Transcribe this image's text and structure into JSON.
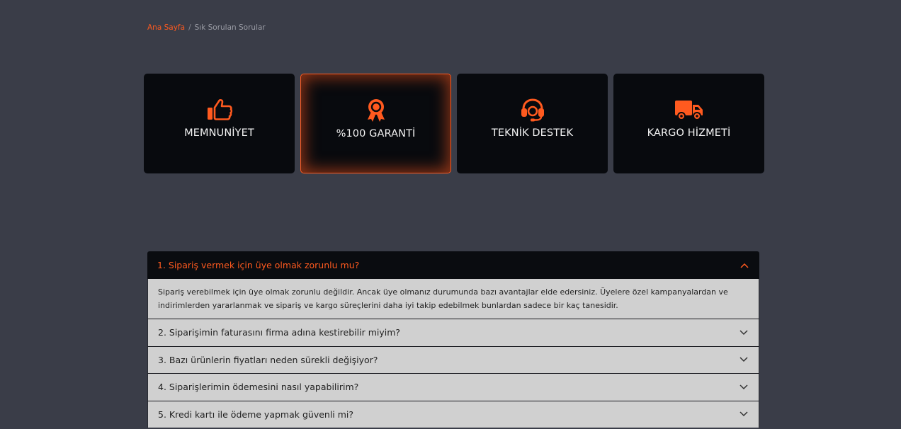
{
  "breadcrumb": {
    "home": "Ana Sayfa",
    "separator": "/",
    "current": "Sık Sorulan Sorular"
  },
  "features": [
    {
      "label": "MEMNUNİYET",
      "icon": "thumbs-up-icon"
    },
    {
      "label": "%100 GARANTİ",
      "icon": "award-ribbon-icon"
    },
    {
      "label": "TEKNİK DESTEK",
      "icon": "headset-icon"
    },
    {
      "label": "KARGO HİZMETİ",
      "icon": "truck-icon"
    }
  ],
  "faq": {
    "open": {
      "question": "1. Sipariş vermek için üye olmak zorunlu mu?",
      "answer": "Sipariş verebilmek için üye olmak zorunlu değildir. Ancak üye olmanız durumunda bazı avantajlar elde edersiniz. Üyelere özel kampanyalardan ve indirimlerden yararlanmak ve sipariş ve kargo süreçlerini daha iyi takip edebilmek bunlardan sadece bir kaç tanesidir."
    },
    "items": [
      "2. Siparişimin faturasını firma adına kestirebilir miyim?",
      "3. Bazı ürünlerin fiyatları neden sürekli değişiyor?",
      "4. Siparişlerimin ödemesini nasıl yapabilirim?",
      "5. Kredi kartı ile ödeme yapmak güvenli mi?"
    ]
  },
  "colors": {
    "accent": "#ff5a1f",
    "background": "#3a3d48",
    "card": "#080a0e",
    "faq_panel": "#d0d0d0"
  }
}
